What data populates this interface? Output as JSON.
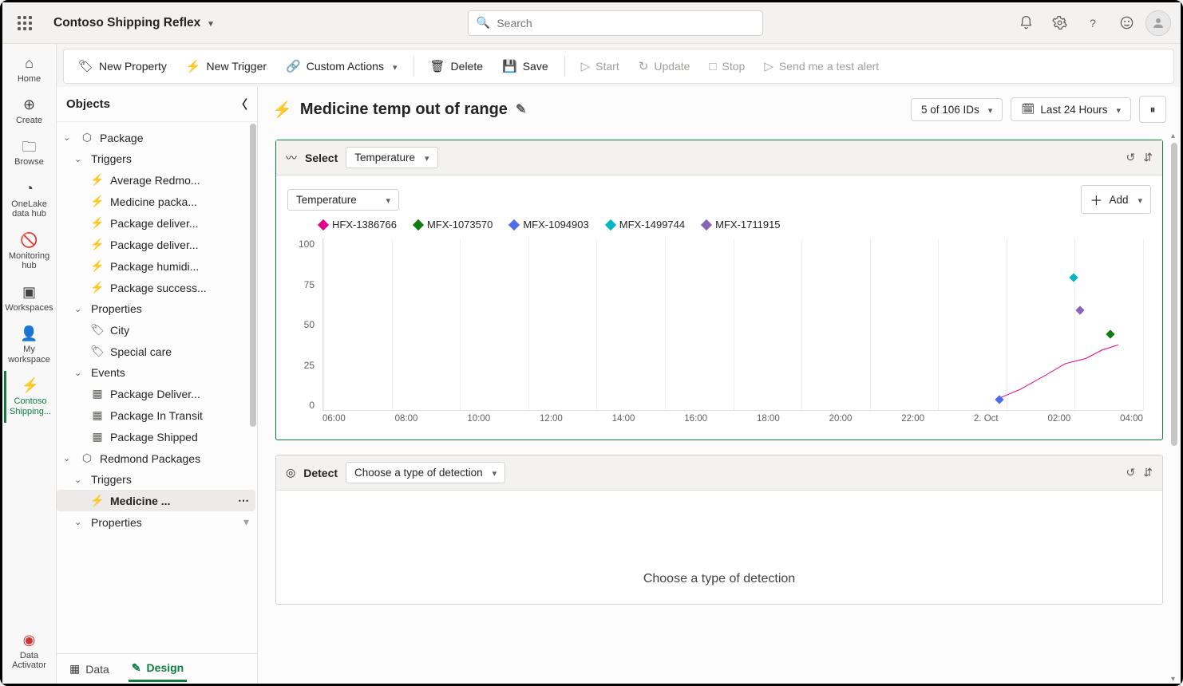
{
  "top": {
    "workspace": "Contoso Shipping Reflex",
    "search_placeholder": "Search"
  },
  "leftrail": {
    "home": "Home",
    "create": "Create",
    "browse": "Browse",
    "onelake": "OneLake data hub",
    "monitoring": "Monitoring hub",
    "workspaces": "Workspaces",
    "myworkspace": "My workspace",
    "contoso": "Contoso Shipping...",
    "data_activator": "Data Activator"
  },
  "ribbon": {
    "new_property": "New Property",
    "new_trigger": "New Trigger",
    "custom_actions": "Custom Actions",
    "delete": "Delete",
    "save": "Save",
    "start": "Start",
    "update": "Update",
    "stop": "Stop",
    "send_test": "Send me a test alert"
  },
  "objects": {
    "title": "Objects",
    "package": "Package",
    "triggers": "Triggers",
    "t1": "Average Redmo...",
    "t2": "Medicine packa...",
    "t3": "Package deliver...",
    "t4": "Package deliver...",
    "t5": "Package humidi...",
    "t6": "Package success...",
    "properties": "Properties",
    "p_city": "City",
    "p_special": "Special care",
    "events": "Events",
    "e1": "Package Deliver...",
    "e2": "Package In Transit",
    "e3": "Package Shipped",
    "redmond": "Redmond Packages",
    "rt1": "Medicine ...",
    "rprops": "Properties"
  },
  "footer": {
    "data": "Data",
    "design": "Design"
  },
  "canvas": {
    "title": "Medicine temp out of range",
    "ids": "5 of 106 IDs",
    "timerange": "Last 24 Hours",
    "select": "Select",
    "temperature": "Temperature",
    "add": "Add",
    "detect": "Detect",
    "detect_dd": "Choose a type of detection",
    "detect_placeholder": "Choose a type of detection"
  },
  "chart_data": {
    "type": "line",
    "ylim": [
      0,
      100
    ],
    "yticks": [
      0,
      25,
      50,
      75,
      100
    ],
    "xlabels": [
      "06:00",
      "08:00",
      "10:00",
      "12:00",
      "14:00",
      "16:00",
      "18:00",
      "20:00",
      "22:00",
      "2. Oct",
      "02:00",
      "04:00"
    ],
    "series": [
      {
        "name": "HFX-1386766",
        "color": "#e3008c",
        "type": "line",
        "points": [
          {
            "xpct": 82.0,
            "y": 6
          },
          {
            "xpct": 85.0,
            "y": 12
          },
          {
            "xpct": 88.0,
            "y": 20
          },
          {
            "xpct": 90.5,
            "y": 27
          },
          {
            "xpct": 93.0,
            "y": 30
          },
          {
            "xpct": 95.0,
            "y": 35
          },
          {
            "xpct": 97.0,
            "y": 38
          }
        ]
      },
      {
        "name": "MFX-1073570",
        "color": "#107c10",
        "type": "point",
        "xpct": 96.0,
        "y": 44
      },
      {
        "name": "MFX-1094903",
        "color": "#4f6bed",
        "type": "point",
        "xpct": 82.5,
        "y": 6
      },
      {
        "name": "MFX-1499744",
        "color": "#00b7c3",
        "type": "point",
        "xpct": 91.5,
        "y": 77
      },
      {
        "name": "MFX-1711915",
        "color": "#8764b8",
        "type": "point",
        "xpct": 92.3,
        "y": 58
      }
    ]
  }
}
